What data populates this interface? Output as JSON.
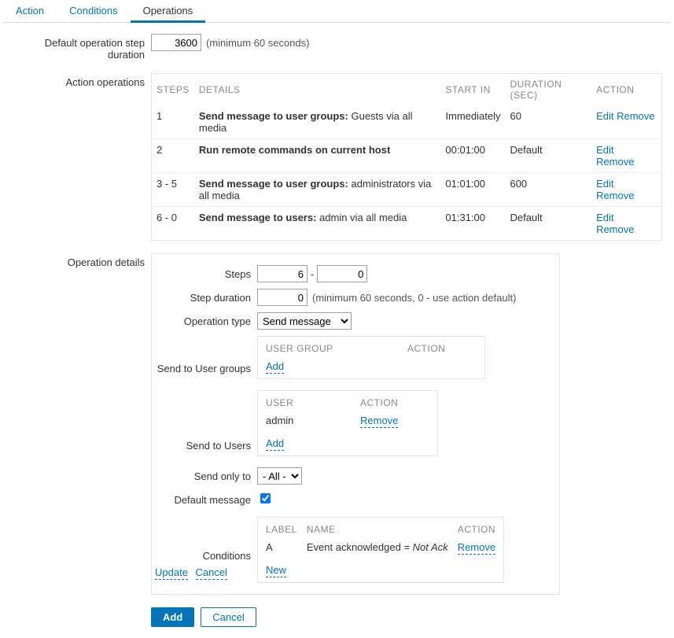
{
  "tabs": {
    "action": "Action",
    "conditions": "Conditions",
    "operations": "Operations"
  },
  "stepDuration": {
    "label": "Default operation step duration",
    "value": "3600",
    "hint": "(minimum 60 seconds)"
  },
  "operationsLabel": "Action operations",
  "opsTable": {
    "headers": {
      "steps": "STEPS",
      "details": "DETAILS",
      "startIn": "START IN",
      "duration": "DURATION (SEC)",
      "action": "ACTION"
    },
    "rows": [
      {
        "steps": "1",
        "prefix": "Send message to user groups:",
        "suffix": " Guests via all media",
        "startIn": "Immediately",
        "duration": "60"
      },
      {
        "steps": "2",
        "prefix": "Run remote commands on current host",
        "suffix": "",
        "startIn": "00:01:00",
        "duration": "Default"
      },
      {
        "steps": "3 - 5",
        "prefix": "Send message to user groups:",
        "suffix": " administrators via all media",
        "startIn": "01:01:00",
        "duration": "600"
      },
      {
        "steps": "6 - 0",
        "prefix": "Send message to users:",
        "suffix": " admin via all media",
        "startIn": "01:31:00",
        "duration": "Default"
      }
    ],
    "editLabel": "Edit",
    "removeLabel": "Remove"
  },
  "details": {
    "panelLabel": "Operation details",
    "stepsLabel": "Steps",
    "stepsFrom": "6",
    "stepsTo": "0",
    "stepDurLabel": "Step duration",
    "stepDurValue": "0",
    "stepDurHint": "(minimum 60 seconds, 0 - use action default)",
    "opTypeLabel": "Operation type",
    "opTypeValue": "Send message",
    "userGroups": {
      "label": "Send to User groups",
      "header1": "USER GROUP",
      "header2": "ACTION",
      "addLabel": "Add"
    },
    "users": {
      "label": "Send to Users",
      "header1": "USER",
      "header2": "ACTION",
      "row1User": "admin",
      "removeLabel": "Remove",
      "addLabel": "Add"
    },
    "sendOnly": {
      "label": "Send only to",
      "value": "- All -"
    },
    "defaultMsg": {
      "label": "Default message",
      "checked": true
    },
    "conditions": {
      "label": "Conditions",
      "header1": "LABEL",
      "header2": "NAME",
      "header3": "ACTION",
      "rowLabel": "A",
      "rowNamePrefix": "Event acknowledged = ",
      "rowNameItalic": "Not Ack",
      "removeLabel": "Remove",
      "newLabel": "New"
    },
    "updateLabel": "Update",
    "cancelLabel": "Cancel"
  },
  "footer": {
    "add": "Add",
    "cancel": "Cancel"
  }
}
